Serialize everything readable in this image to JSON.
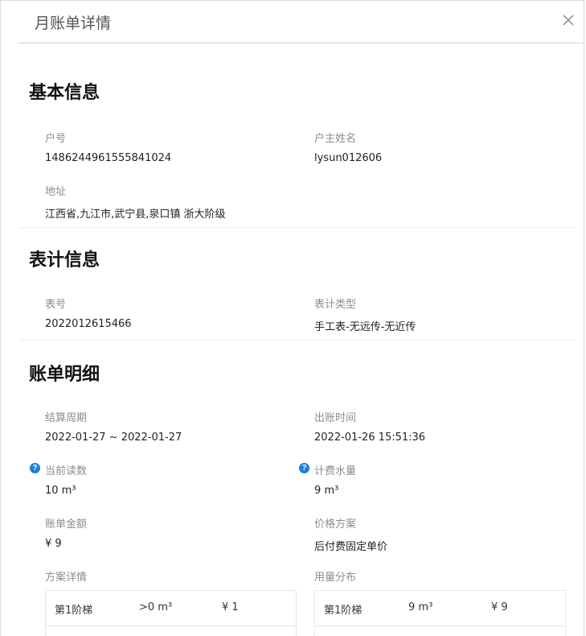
{
  "modal": {
    "title": "月账单详情"
  },
  "basic_info": {
    "title": "基本信息",
    "account_no_label": "户号",
    "account_no_value": "1486244961555841024",
    "owner_label": "户主姓名",
    "owner_value": "lysun012606",
    "address_label": "地址",
    "address_value": "江西省,九江市,武宁县,泉口镇 浙大阶级"
  },
  "meter_info": {
    "title": "表计信息",
    "meter_no_label": "表号",
    "meter_no_value": "2022012615466",
    "meter_type_label": "表计类型",
    "meter_type_value": "手工表-无远传-无近传"
  },
  "bill_detail": {
    "title": "账单明细",
    "period_label": "结算周期",
    "period_value": "2022-01-27 ~ 2022-01-27",
    "issue_time_label": "出账时间",
    "issue_time_value": "2022-01-26 15:51:36",
    "current_reading_label": "当前读数",
    "current_reading_value": "10 m³",
    "billed_volume_label": "计费水量",
    "billed_volume_value": "9 m³",
    "amount_label": "账单金额",
    "amount_value": "¥ 9",
    "price_plan_label": "价格方案",
    "price_plan_value": "后付费固定单价",
    "plan_detail_label": "方案详情",
    "usage_dist_label": "用量分布",
    "plan_detail_rows": [
      {
        "tier": "第1阶梯",
        "range": ">0 m³",
        "price": "¥ 1"
      }
    ],
    "usage_dist_rows": [
      {
        "tier": "第1阶梯",
        "volume": "9 m³",
        "amount": "¥ 9"
      }
    ]
  },
  "icons": {
    "close": "close-icon",
    "help": "question-circle-icon"
  },
  "colors": {
    "help_icon": "#1b7fe0",
    "label": "#8c8c8c",
    "value": "#222222"
  }
}
